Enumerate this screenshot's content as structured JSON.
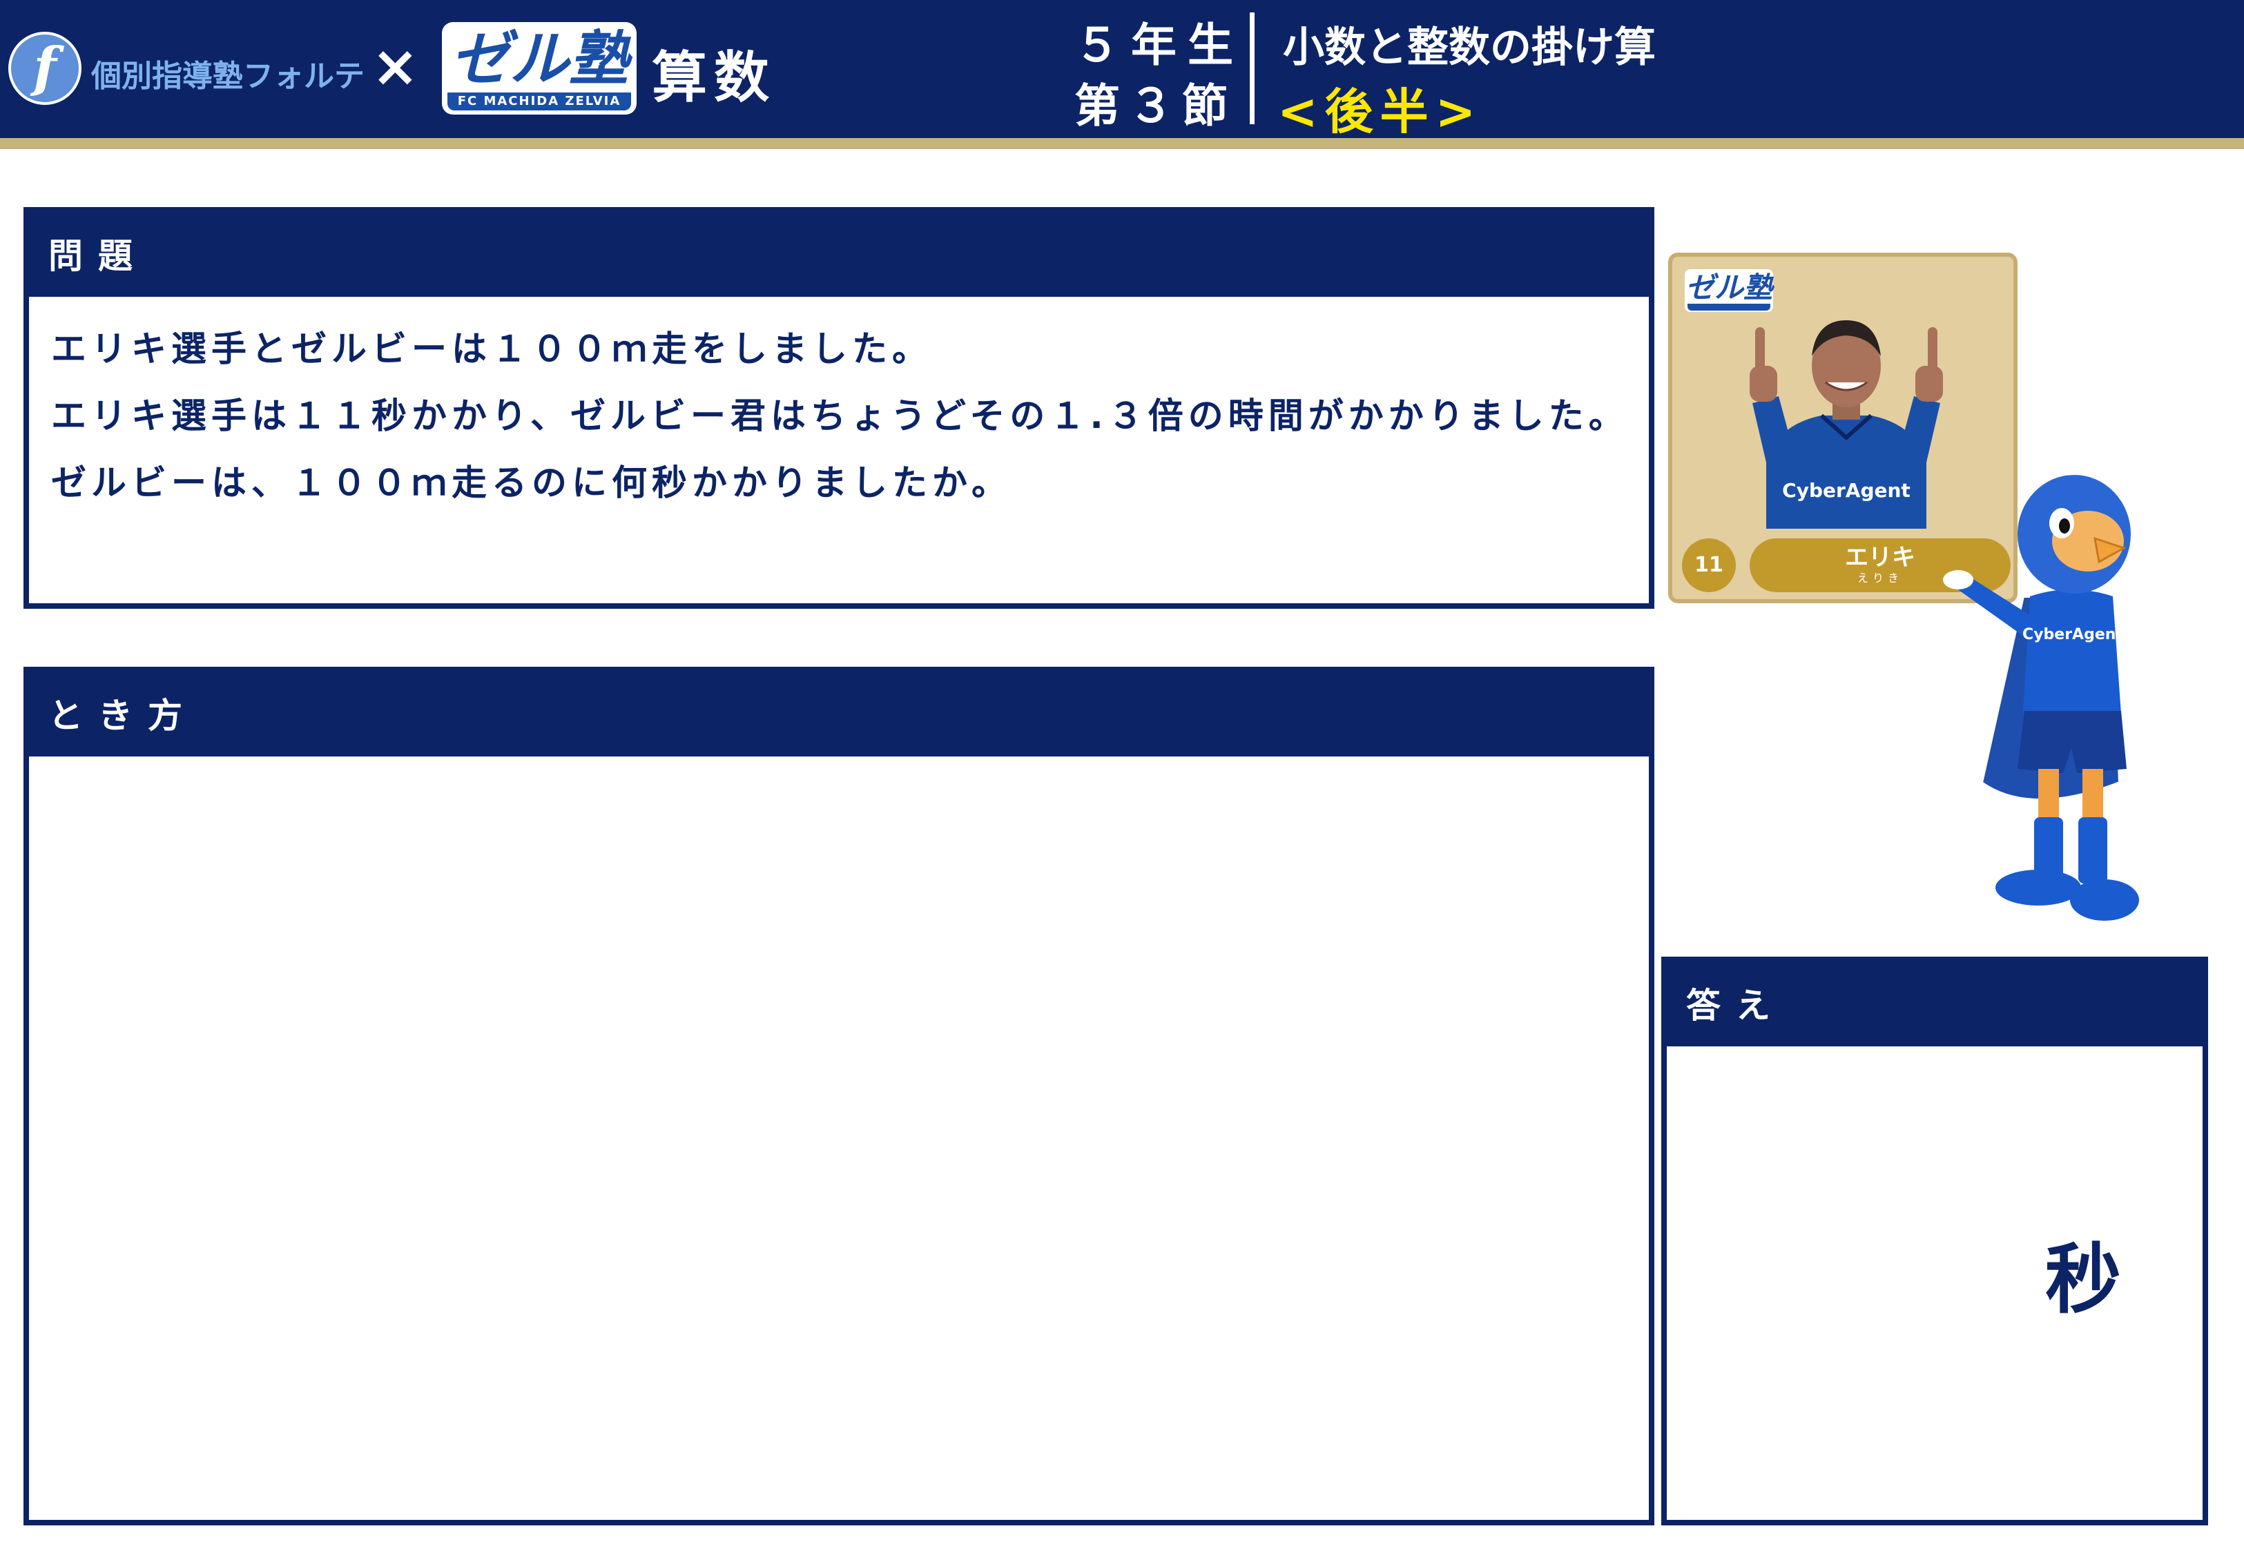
{
  "header": {
    "logo_letter": "f",
    "school_name": "個別指導塾フォルテ",
    "times": "×",
    "zel_logo": {
      "main": "ゼル塾",
      "sub": "FC MACHIDA ZELVIA"
    },
    "subject": "算数",
    "grade": "５年生",
    "lesson": "第３節",
    "topic": "小数と整数の掛け算",
    "half": "<後半>",
    "colors": {
      "navy": "#0c2466",
      "stripe": "#c6b27e",
      "yellow": "#ffe800"
    }
  },
  "problem": {
    "heading": "問題",
    "lines": [
      "エリキ選手とゼルビーは１００ｍ走をしました。",
      "エリキ選手は１１秒かかり、ゼルビー君はちょうどその１.３倍の時間がかかりました。",
      "ゼルビーは、１００ｍ走るのに何秒かかりましたか。"
    ]
  },
  "method": {
    "heading": "とき方"
  },
  "answer": {
    "heading": "答え",
    "unit": "秒"
  },
  "card": {
    "logo": "ゼル塾",
    "number": "11",
    "name": "エリキ",
    "ruby": "えりき",
    "jersey_text": "CyberAgent"
  },
  "mascot": {
    "icon": "zelvie-mascot-icon",
    "jersey_text": "CyberAgent"
  }
}
